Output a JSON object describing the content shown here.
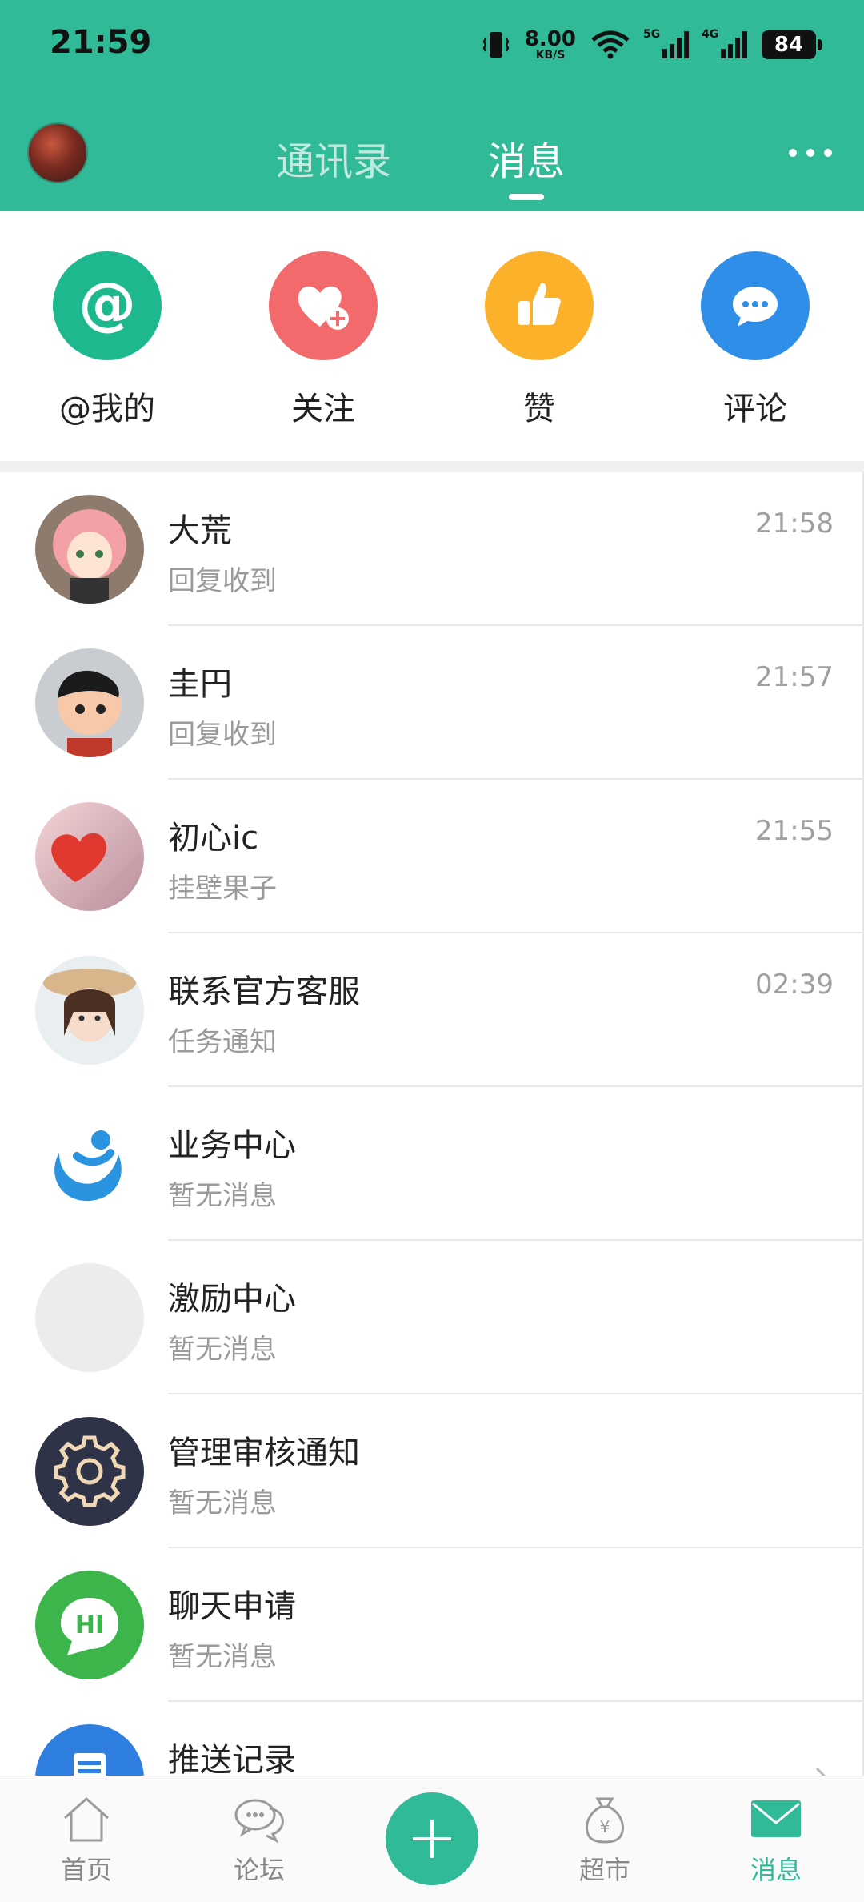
{
  "status_bar": {
    "time": "21:59",
    "net_speed": "8.00",
    "net_unit": "KB/S",
    "sig1_label": "5G",
    "sig2_label": "4G",
    "battery": "84"
  },
  "top_bar": {
    "tabs": [
      {
        "label": "通讯录",
        "active": false
      },
      {
        "label": "消息",
        "active": true
      }
    ]
  },
  "categories": [
    {
      "label": "@我的",
      "color": "#1eb88e",
      "icon": "at-icon"
    },
    {
      "label": "关注",
      "color": "#f26a6b",
      "icon": "heart-plus-icon"
    },
    {
      "label": "赞",
      "color": "#fbb12a",
      "icon": "thumbs-up-icon"
    },
    {
      "label": "评论",
      "color": "#2f8fe8",
      "icon": "comment-icon"
    }
  ],
  "conversations": [
    {
      "name": "大荒",
      "preview": "回复收到",
      "time": "21:58"
    },
    {
      "name": "圭円",
      "preview": "回复收到",
      "time": "21:57"
    },
    {
      "name": "初心ic",
      "preview": "挂壁果子",
      "time": "21:55"
    },
    {
      "name": "联系官方客服",
      "preview": "任务通知",
      "time": "02:39"
    },
    {
      "name": "业务中心",
      "preview": "暂无消息",
      "time": ""
    },
    {
      "name": "激励中心",
      "preview": "暂无消息",
      "time": ""
    },
    {
      "name": "管理审核通知",
      "preview": "暂无消息",
      "time": ""
    },
    {
      "name": "聊天申请",
      "preview": "暂无消息",
      "time": ""
    },
    {
      "name": "推送记录",
      "preview": "",
      "time": ""
    }
  ],
  "chat_request_avatar_text": "HI",
  "bottom_nav": [
    {
      "label": "首页",
      "icon": "home-icon"
    },
    {
      "label": "论坛",
      "icon": "forum-icon"
    },
    {
      "label": "",
      "icon": "plus-icon"
    },
    {
      "label": "超市",
      "icon": "money-bag-icon"
    },
    {
      "label": "消息",
      "icon": "mail-icon",
      "active": true
    }
  ],
  "colors": {
    "brand": "#31ba98"
  }
}
